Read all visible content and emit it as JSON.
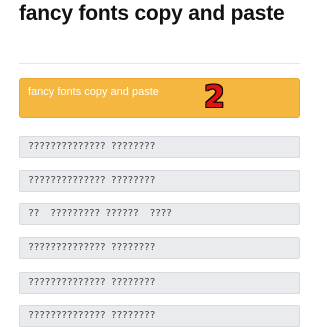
{
  "page": {
    "title": "fancy fonts copy and paste"
  },
  "highlight": {
    "label": "fancy fonts copy and paste",
    "badge": "2",
    "badge_color": "#e01212",
    "bg_color": "#f5b73f"
  },
  "items": [
    "?????????????? ????????",
    "?????????????? ????????",
    "??  ????????? ??????  ????",
    "?????????????? ????????",
    "?????????????? ????????",
    "?????????????? ????????"
  ]
}
